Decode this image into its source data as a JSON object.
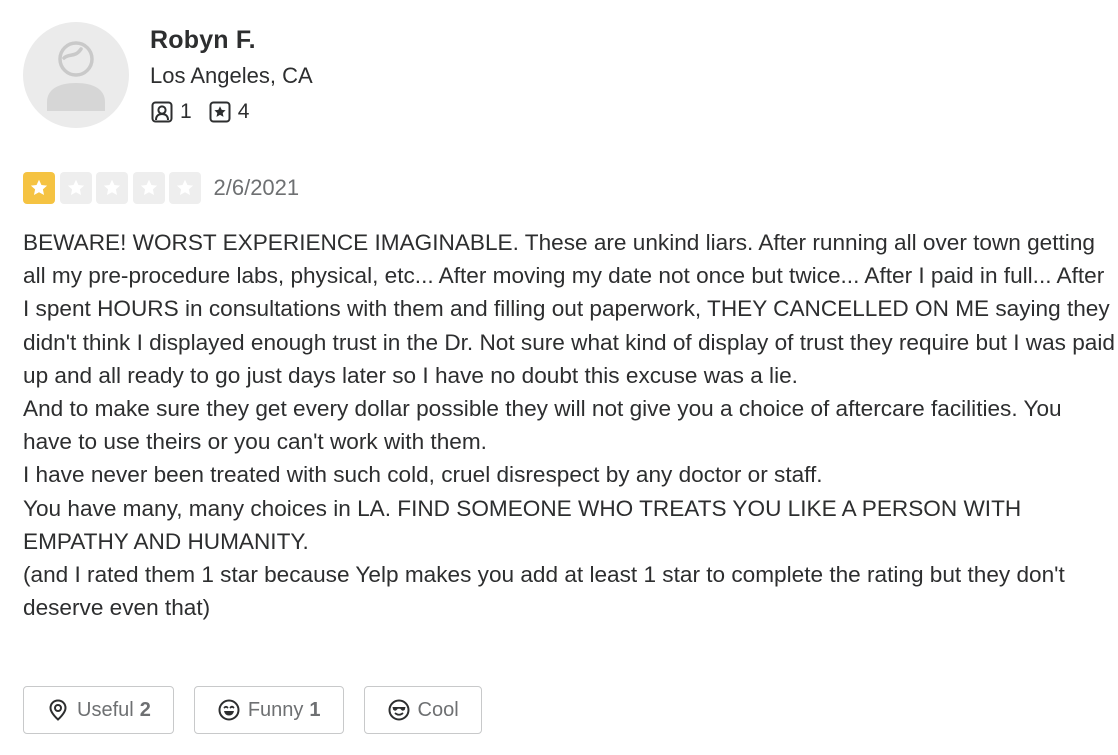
{
  "user": {
    "name": "Robyn F.",
    "location": "Los Angeles, CA",
    "friends_count": "1",
    "reviews_count": "4",
    "avatar_icon": "default-user-avatar-icon"
  },
  "review": {
    "rating": 1,
    "max_rating": 5,
    "date": "2/6/2021",
    "paragraphs": [
      "BEWARE! WORST EXPERIENCE IMAGINABLE. These are unkind liars. After running all over town getting all my pre-procedure labs, physical, etc... After moving my date not once but twice... After I paid in full... After I spent HOURS in consultations with them and filling out paperwork,  THEY CANCELLED ON ME saying they didn't think I displayed enough trust in the Dr. Not sure what kind of display of trust they require but I was paid up and all ready to go just days later so I have no doubt this excuse was a lie.",
      "And to make sure they get every dollar possible they will not give you a choice of aftercare facilities. You have to use theirs or you can't work with them.",
      "I have never been treated with such cold, cruel disrespect by any doctor or staff.",
      "You have many, many choices in LA. FIND SOMEONE WHO TREATS YOU LIKE A PERSON WITH EMPATHY AND HUMANITY.",
      "(and I rated them 1 star because Yelp makes you add at least 1 star to complete the rating but they don't deserve even that)"
    ]
  },
  "actions": {
    "useful_label": "Useful",
    "useful_count": "2",
    "funny_label": "Funny",
    "funny_count": "1",
    "cool_label": "Cool"
  },
  "colors": {
    "star_filled": "#f5c342",
    "star_empty": "#eeeeee",
    "text": "#2d2e2f",
    "muted": "#6e7072"
  }
}
